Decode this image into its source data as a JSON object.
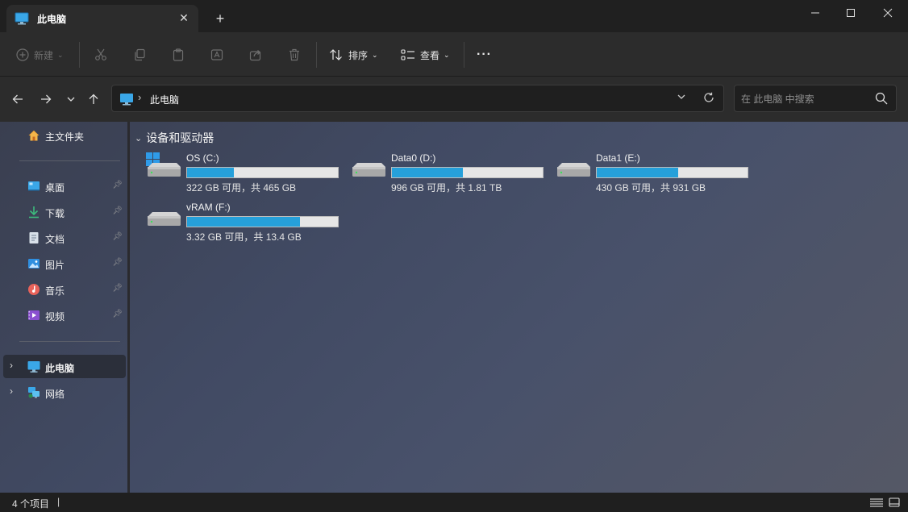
{
  "window": {
    "tab_title": "此电脑",
    "tab_icon": "monitor-icon"
  },
  "toolbar": {
    "new_label": "新建",
    "sort_label": "排序",
    "view_label": "查看",
    "more_label": "···"
  },
  "address": {
    "location": "此电脑",
    "search_placeholder": "在 此电脑 中搜索"
  },
  "sidebar": {
    "home": "主文件夹",
    "quick": [
      {
        "label": "桌面",
        "icon": "desktop-icon"
      },
      {
        "label": "下载",
        "icon": "download-icon"
      },
      {
        "label": "文档",
        "icon": "document-icon"
      },
      {
        "label": "图片",
        "icon": "pictures-icon"
      },
      {
        "label": "音乐",
        "icon": "music-icon"
      },
      {
        "label": "视频",
        "icon": "video-icon"
      }
    ],
    "this_pc": "此电脑",
    "network": "网络"
  },
  "content": {
    "section_title": "设备和驱动器",
    "drives": [
      {
        "name": "OS (C:)",
        "free": "322 GB 可用，共 465 GB",
        "used_fraction": 0.31
      },
      {
        "name": "Data0 (D:)",
        "free": "996 GB 可用，共 1.81 TB",
        "used_fraction": 0.47
      },
      {
        "name": "Data1 (E:)",
        "free": "430 GB 可用，共 931 GB",
        "used_fraction": 0.54
      },
      {
        "name": "vRAM (F:)",
        "free": "3.32 GB 可用，共 13.4 GB",
        "used_fraction": 0.75
      }
    ]
  },
  "status": {
    "count_text": "4 个项目"
  },
  "colors": {
    "accent": "#26a0da"
  }
}
